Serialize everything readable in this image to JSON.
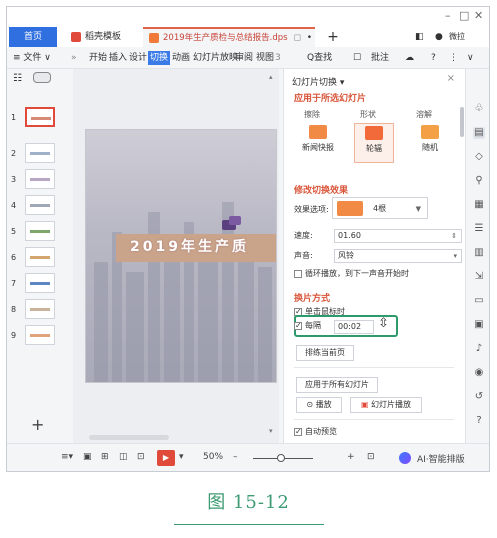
{
  "titlebar": {
    "home_tab": "首页",
    "template_tab": "稻壳模板",
    "doc_tab": "2019年生产质检与总结报告.dps",
    "user_name": "微拉",
    "minimize": "–",
    "maximize": "□",
    "close": "✕",
    "plus": "+"
  },
  "menubar": {
    "file": "≡ 文件 ∨",
    "more": "»",
    "items": [
      "开始",
      "插入",
      "设计",
      "切换",
      "动画",
      "幻灯片放映",
      "审阅",
      "视图",
      "3"
    ],
    "active_index": 3,
    "search": "Q查找",
    "comment": "批注",
    "help": "?"
  },
  "thumbnails": {
    "numbers": [
      "1",
      "2",
      "3",
      "4",
      "5",
      "6",
      "7",
      "8",
      "9"
    ],
    "add": "+"
  },
  "slide": {
    "title": "2019年生产质"
  },
  "panel": {
    "header": "幻灯片切换 ▾",
    "close": "×",
    "apply_title": "应用于所选幻灯片",
    "top_labels": [
      "擦除",
      "形状",
      "溶解"
    ],
    "effects": [
      {
        "label": "新闻快报",
        "icon": "news-flash-icon"
      },
      {
        "label": "轮辐",
        "icon": "wheel-icon"
      },
      {
        "label": "随机",
        "icon": "random-icon"
      }
    ],
    "selected_effect": 1,
    "modify_title": "修改切换效果",
    "effect_option_label": "效果选项:",
    "effect_option_value": "4根",
    "speed_label": "速度:",
    "speed_value": "01.60",
    "sound_label": "声音:",
    "sound_value": "风铃",
    "loop_label": "循环播放，到下一声音开始时",
    "advance_title": "换片方式",
    "on_click_label": "单击鼠标时",
    "every_label": "每隔",
    "every_value": "00:02",
    "rehearse_button": "排练当前页",
    "apply_all_button": "应用于所有幻灯片",
    "play_button": "播放",
    "slideshow_button": "幻灯片播放",
    "autopreview_label": "自动预览"
  },
  "statusbar": {
    "zoom": "50%",
    "minus": "–",
    "plus": "+",
    "ai_label": "AI·智能排版"
  },
  "caption": {
    "text": "图 15-12"
  },
  "colors": {
    "accent_blue": "#2f6fe0",
    "accent_orange": "#d9553a",
    "highlight_green": "#2e9a6c"
  }
}
